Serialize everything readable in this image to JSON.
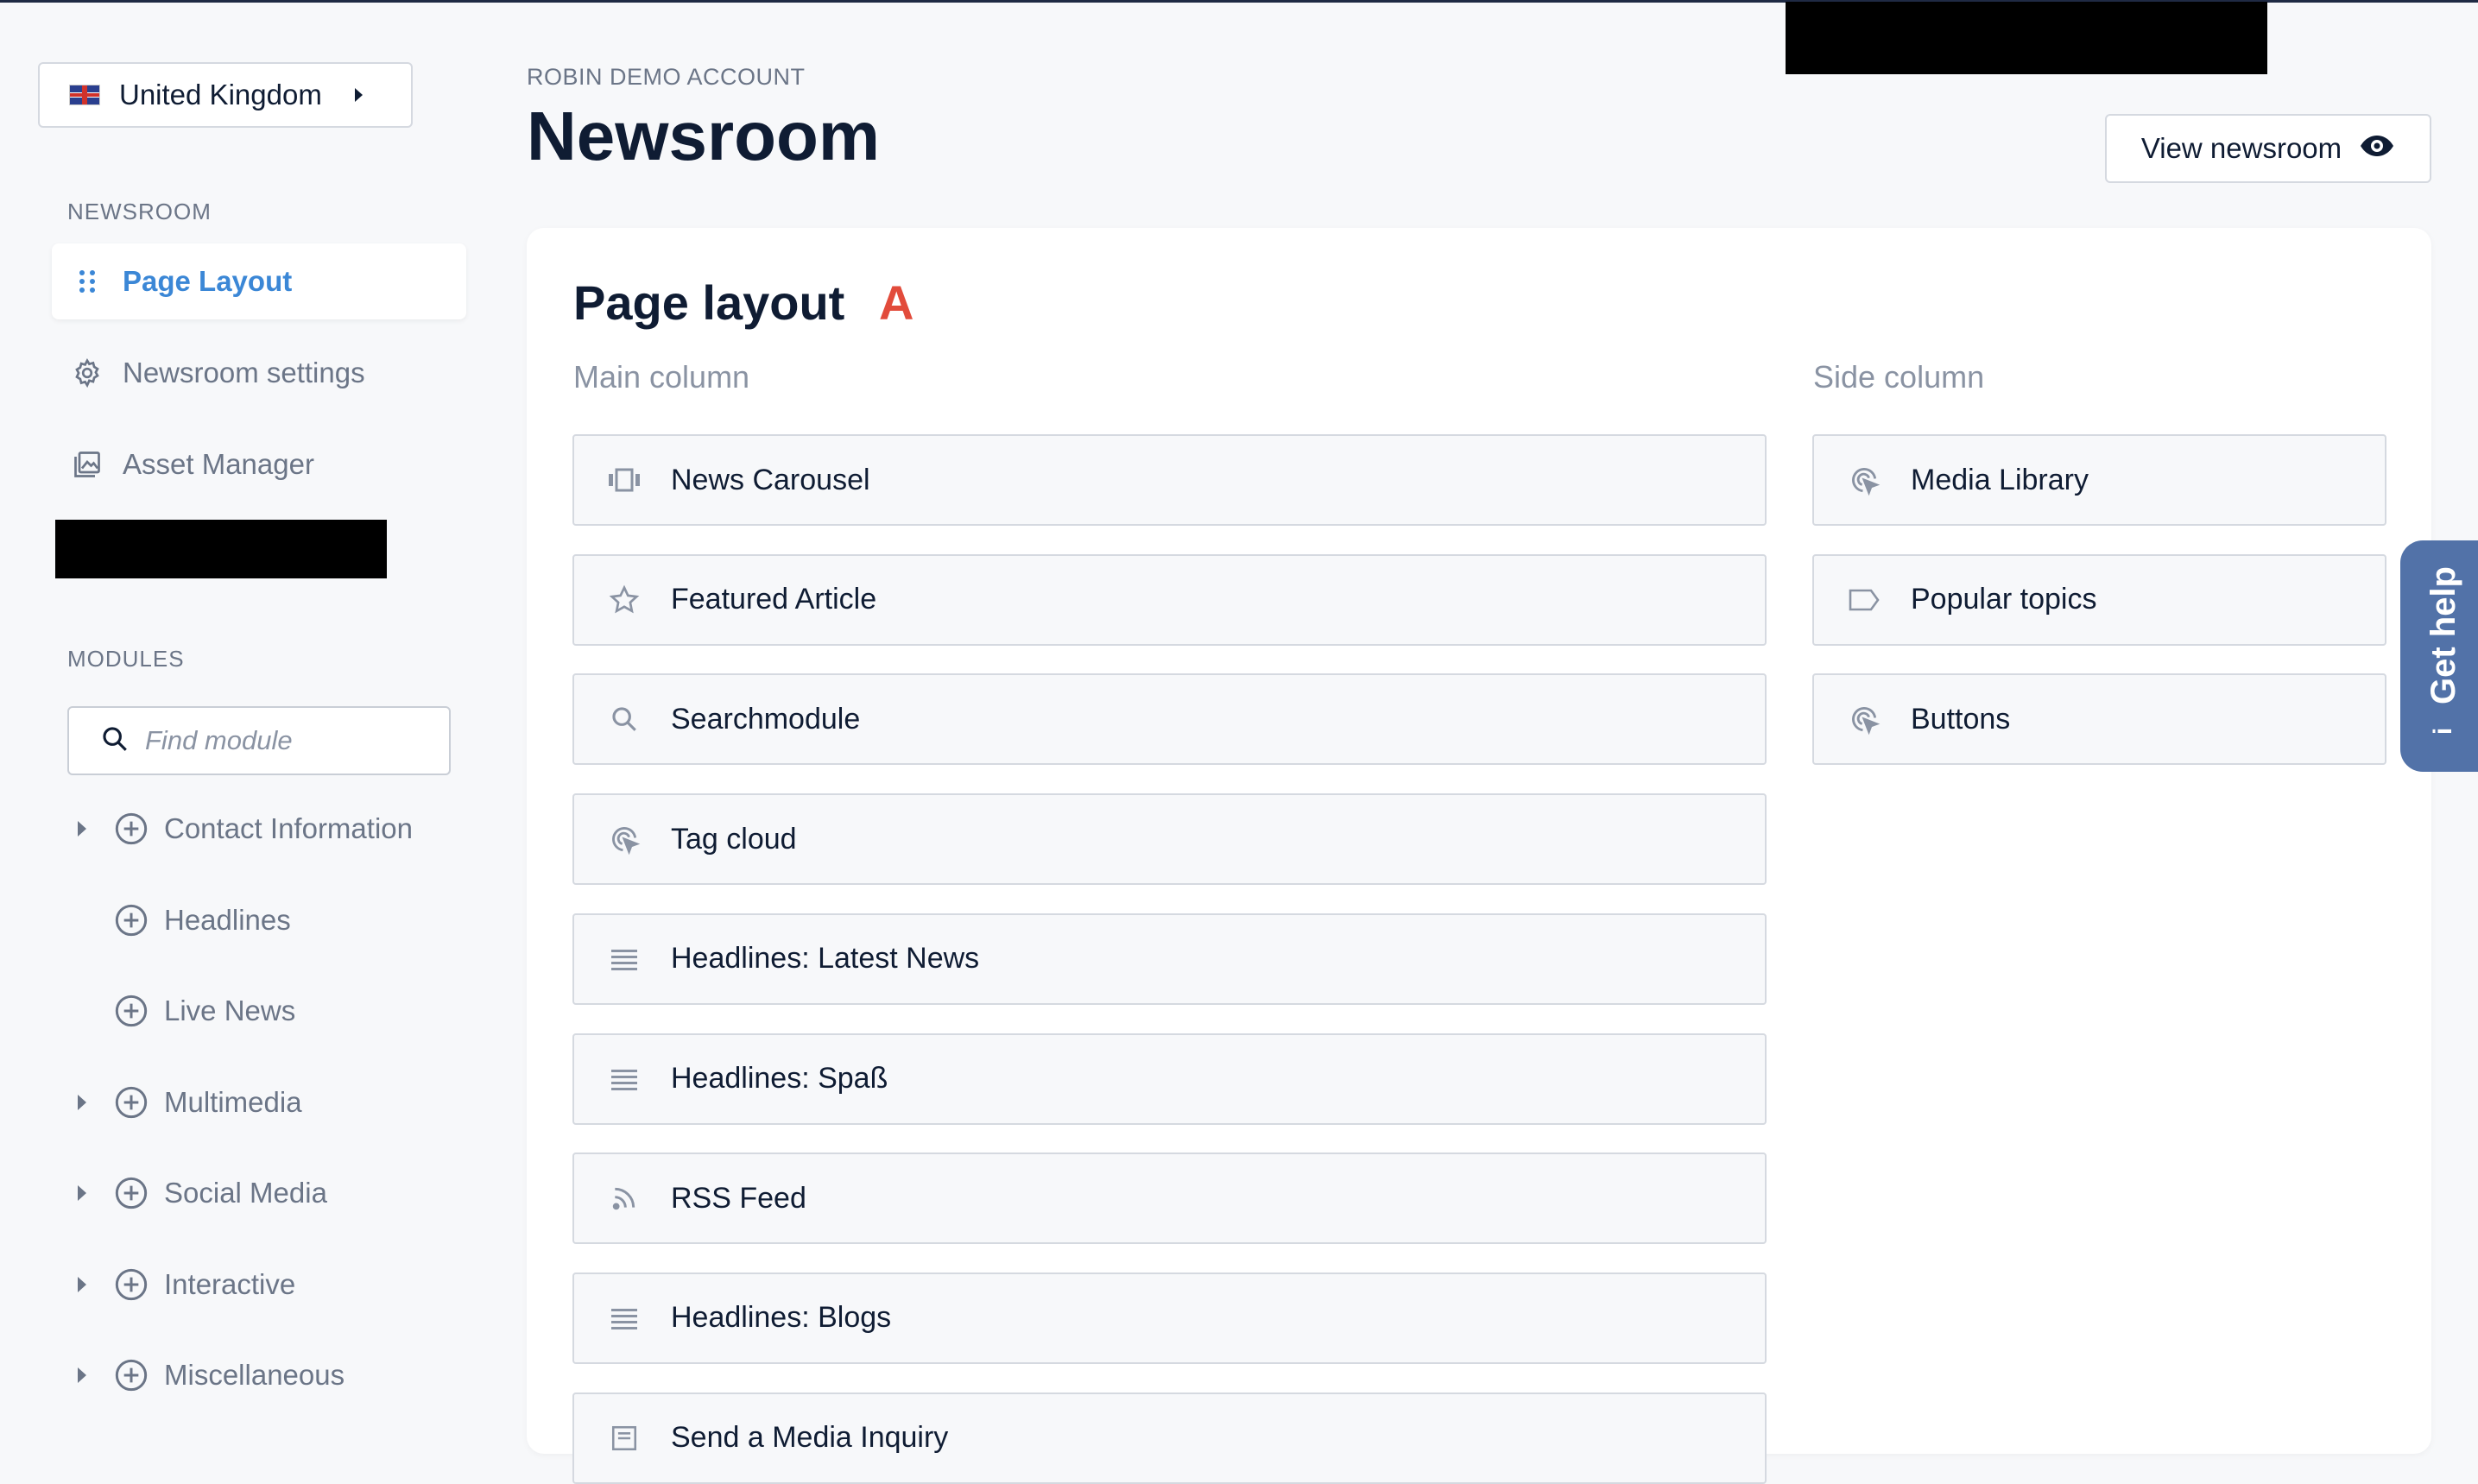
{
  "sidebar": {
    "country": "United Kingdom",
    "newsroom_label": "NEWSROOM",
    "nav": [
      {
        "label": "Page Layout",
        "icon": "drag-dots-icon",
        "active": true
      },
      {
        "label": "Newsroom settings",
        "icon": "gear-icon",
        "active": false
      },
      {
        "label": "Asset Manager",
        "icon": "image-gallery-icon",
        "active": false
      }
    ],
    "modules_label": "MODULES",
    "search_placeholder": "Find module",
    "modules": [
      {
        "label": "Contact Information",
        "expandable": true
      },
      {
        "label": "Headlines",
        "expandable": false
      },
      {
        "label": "Live News",
        "expandable": false
      },
      {
        "label": "Multimedia",
        "expandable": true
      },
      {
        "label": "Social Media",
        "expandable": true
      },
      {
        "label": "Interactive",
        "expandable": true
      },
      {
        "label": "Miscellaneous",
        "expandable": true
      }
    ]
  },
  "header": {
    "account": "ROBIN DEMO ACCOUNT",
    "title": "Newsroom",
    "view_button": "View newsroom"
  },
  "layout": {
    "title": "Page layout",
    "badge": "A",
    "main_label": "Main column",
    "side_label": "Side column",
    "main_blocks": [
      {
        "label": "News Carousel",
        "icon": "carousel-icon"
      },
      {
        "label": "Featured Article",
        "icon": "star-icon"
      },
      {
        "label": "Searchmodule",
        "icon": "search-icon"
      },
      {
        "label": "Tag cloud",
        "icon": "click-target-icon"
      },
      {
        "label": "Headlines: Latest News",
        "icon": "list-lines-icon"
      },
      {
        "label": "Headlines: Spaß",
        "icon": "list-lines-icon"
      },
      {
        "label": "RSS Feed",
        "icon": "rss-icon"
      },
      {
        "label": "Headlines: Blogs",
        "icon": "list-lines-icon"
      },
      {
        "label": "Send a Media Inquiry",
        "icon": "form-icon"
      }
    ],
    "side_blocks": [
      {
        "label": "Media Library",
        "icon": "click-target-icon"
      },
      {
        "label": "Popular topics",
        "icon": "tag-icon"
      },
      {
        "label": "Buttons",
        "icon": "click-target-icon"
      }
    ]
  },
  "help": {
    "label": "Get help"
  },
  "colors": {
    "accent": "#3b87d6",
    "badge": "#e24b3b",
    "help_tab": "#5272a8",
    "title": "#0f1c33"
  }
}
